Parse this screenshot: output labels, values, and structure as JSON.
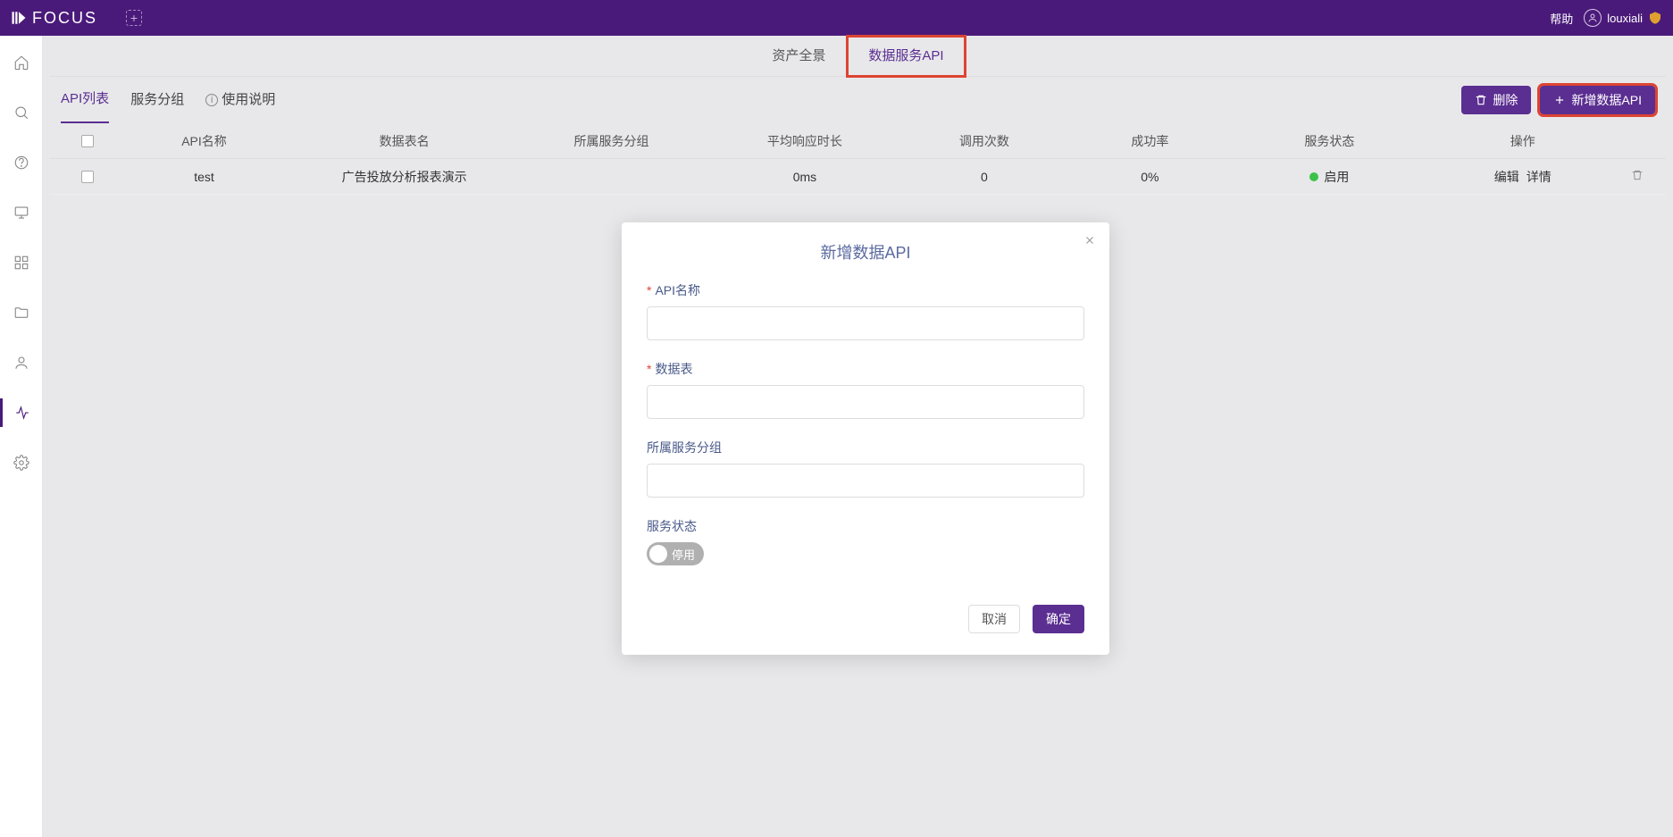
{
  "header": {
    "logo_text": "FOCUS",
    "help_label": "帮助",
    "username": "louxiali"
  },
  "subnav": {
    "tab1": "资产全景",
    "tab2": "数据服务API"
  },
  "inner_tabs": {
    "tab1": "API列表",
    "tab2": "服务分组",
    "tab3": "使用说明"
  },
  "actions": {
    "delete_label": "删除",
    "add_label": "新增数据API"
  },
  "table": {
    "headers": {
      "name": "API名称",
      "table": "数据表名",
      "group": "所属服务分组",
      "avg_time": "平均响应时长",
      "calls": "调用次数",
      "success": "成功率",
      "status": "服务状态",
      "ops": "操作"
    },
    "rows": [
      {
        "name": "test",
        "table": "广告投放分析报表演示",
        "group": "",
        "avg_time": "0ms",
        "calls": "0",
        "success": "0%",
        "status": "启用",
        "op_edit": "编辑",
        "op_detail": "详情"
      }
    ]
  },
  "modal": {
    "title": "新增数据API",
    "field_api_name": "API名称",
    "field_data_table": "数据表",
    "field_group": "所属服务分组",
    "field_status": "服务状态",
    "toggle_off_label": "停用",
    "cancel": "取消",
    "confirm": "确定"
  }
}
